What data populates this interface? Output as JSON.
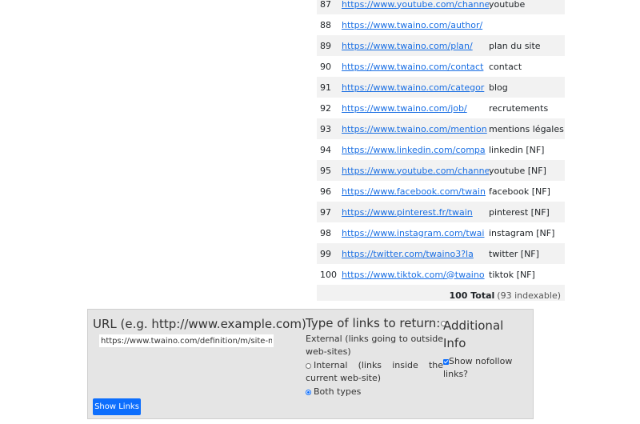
{
  "results": {
    "rows": [
      {
        "num": "87",
        "url": "https://www.youtube.com/channe",
        "anchor": "youtube"
      },
      {
        "num": "88",
        "url": "https://www.twaino.com/author/",
        "anchor": ""
      },
      {
        "num": "89",
        "url": "https://www.twaino.com/plan/",
        "anchor": "plan du site"
      },
      {
        "num": "90",
        "url": "https://www.twaino.com/contact",
        "anchor": "contact"
      },
      {
        "num": "91",
        "url": "https://www.twaino.com/categor",
        "anchor": "blog"
      },
      {
        "num": "92",
        "url": "https://www.twaino.com/job/",
        "anchor": "recrutements"
      },
      {
        "num": "93",
        "url": "https://www.twaino.com/mention",
        "anchor": "mentions légales"
      },
      {
        "num": "94",
        "url": "https://www.linkedin.com/compa",
        "anchor": "linkedin [NF]"
      },
      {
        "num": "95",
        "url": "https://www.youtube.com/channe",
        "anchor": "youtube [NF]"
      },
      {
        "num": "96",
        "url": "https://www.facebook.com/twain",
        "anchor": "facebook [NF]"
      },
      {
        "num": "97",
        "url": "https://www.pinterest.fr/twain",
        "anchor": "pinterest [NF]"
      },
      {
        "num": "98",
        "url": "https://www.instagram.com/twai",
        "anchor": "instagram [NF]"
      },
      {
        "num": "99",
        "url": "https://twitter.com/twaino3?la",
        "anchor": "twitter [NF]"
      },
      {
        "num": "100",
        "url": "https://www.tiktok.com/@twaino",
        "anchor": "tiktok [NF]"
      }
    ],
    "total_label": "100 Total",
    "indexable_label": "(93 indexable)"
  },
  "form": {
    "url_label": "URL (e.g. http://www.example.com)",
    "url_value": "https://www.twaino.com/definition/m/site-m",
    "type_title": "Type of links to return:",
    "options": [
      {
        "label": "External (links going to outside web-sites)",
        "checked": false
      },
      {
        "label": "Internal (links inside the current web-site)",
        "checked": false
      },
      {
        "label": "Both types",
        "checked": true
      }
    ],
    "info_title": "Additional Info",
    "nofollow_label": "Show nofollow links?",
    "nofollow_checked": true,
    "button_label": "Show Links"
  },
  "colors": {
    "link": "#1a6fe3",
    "button": "#0d6efd",
    "panel": "#e5e5e5",
    "stripe": "#f2f2f2"
  }
}
